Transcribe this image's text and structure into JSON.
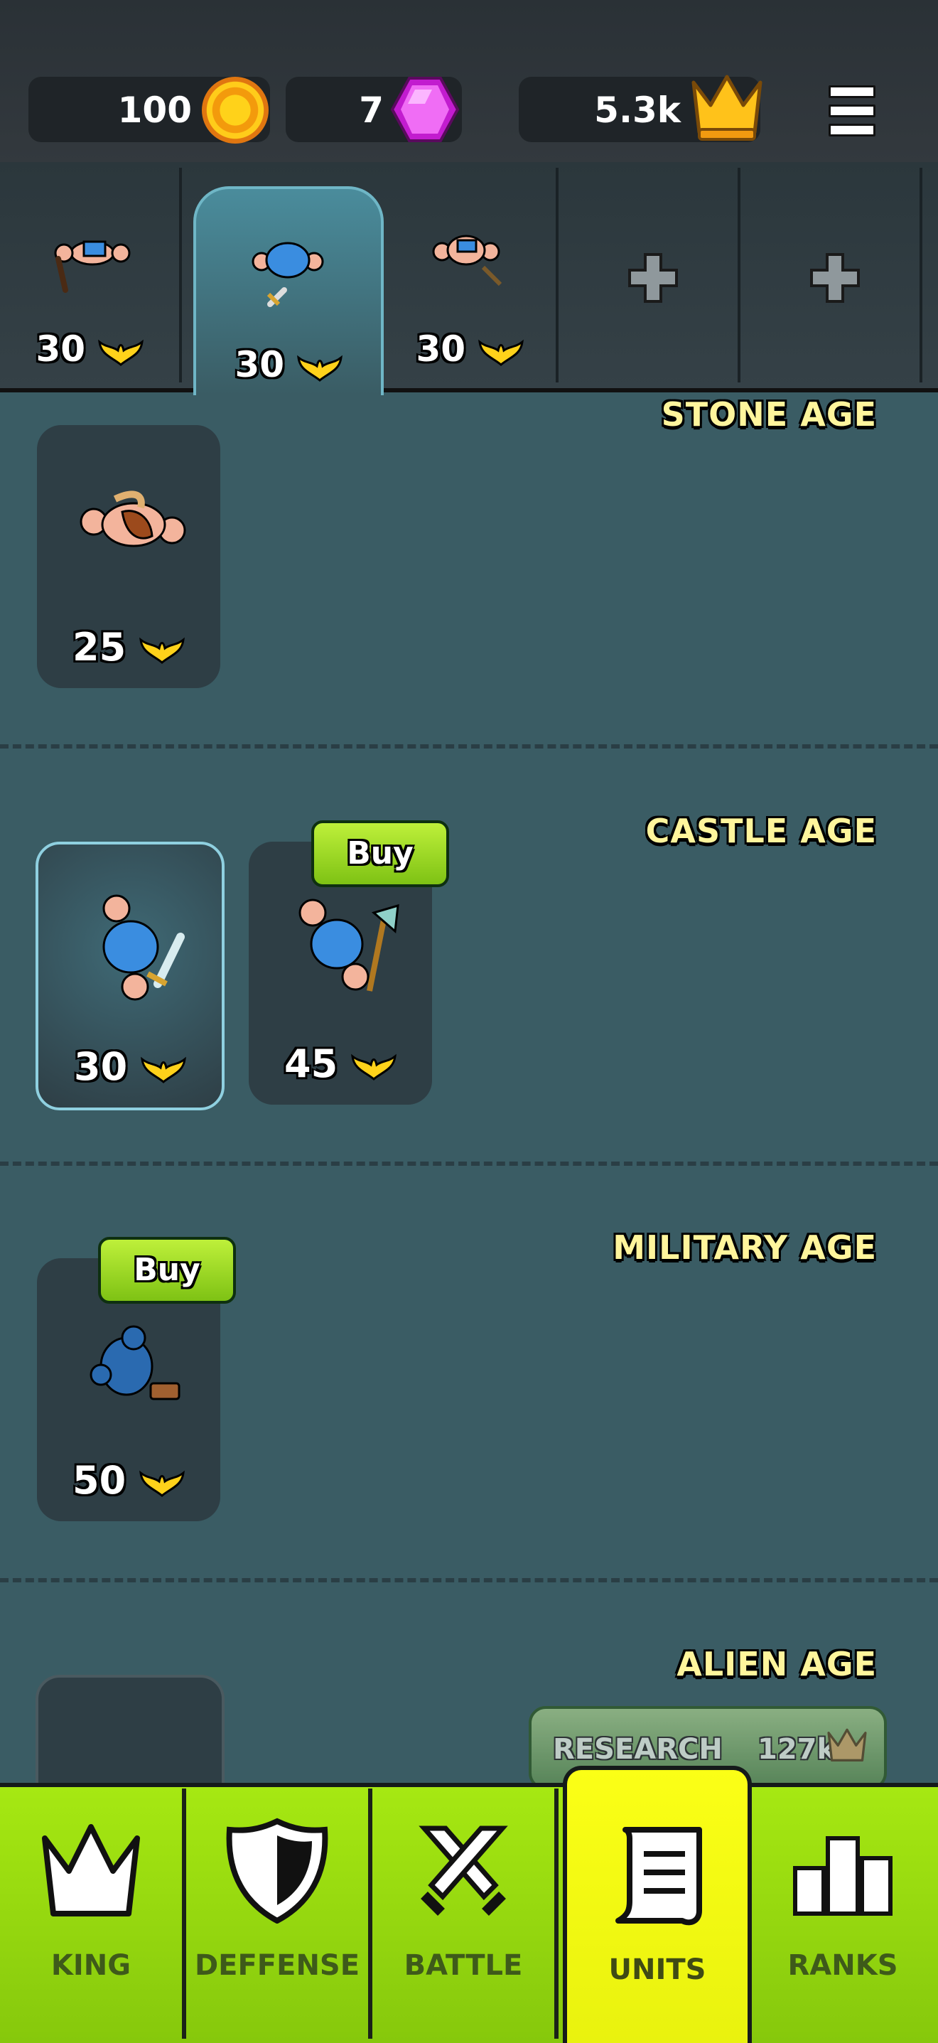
{
  "currency": {
    "coins": "100",
    "gems": "7",
    "crowns": "5.3k"
  },
  "colors": {
    "accent": "#a6e812",
    "active_tab": "#f6fb14",
    "title": "#fff59c"
  },
  "icons": {
    "coin": "coin-icon",
    "gem": "gem-icon",
    "crown": "crown-icon",
    "menu": "menu-icon",
    "wings": "wings-icon",
    "plus": "plus-icon"
  },
  "squad": [
    {
      "cost": "30"
    },
    {
      "cost": "30"
    },
    {
      "cost": "30"
    },
    {
      "empty": true
    },
    {
      "empty": true
    }
  ],
  "ages": [
    {
      "title": "STONE AGE",
      "units": [
        {
          "cost": "25"
        }
      ]
    },
    {
      "title": "CASTLE AGE",
      "units": [
        {
          "cost": "30"
        },
        {
          "cost": "45",
          "buy": "Buy"
        }
      ]
    },
    {
      "title": "MILITARY AGE",
      "units": [
        {
          "cost": "50",
          "buy": "Buy"
        }
      ]
    },
    {
      "title": "ALIEN AGE",
      "research": {
        "label": "RESEARCH",
        "cost": "127k"
      }
    }
  ],
  "nav": [
    {
      "label": "KING"
    },
    {
      "label": "DEFFENSE"
    },
    {
      "label": "BATTLE"
    },
    {
      "label": "UNITS",
      "active": true
    },
    {
      "label": "RANKS"
    }
  ]
}
